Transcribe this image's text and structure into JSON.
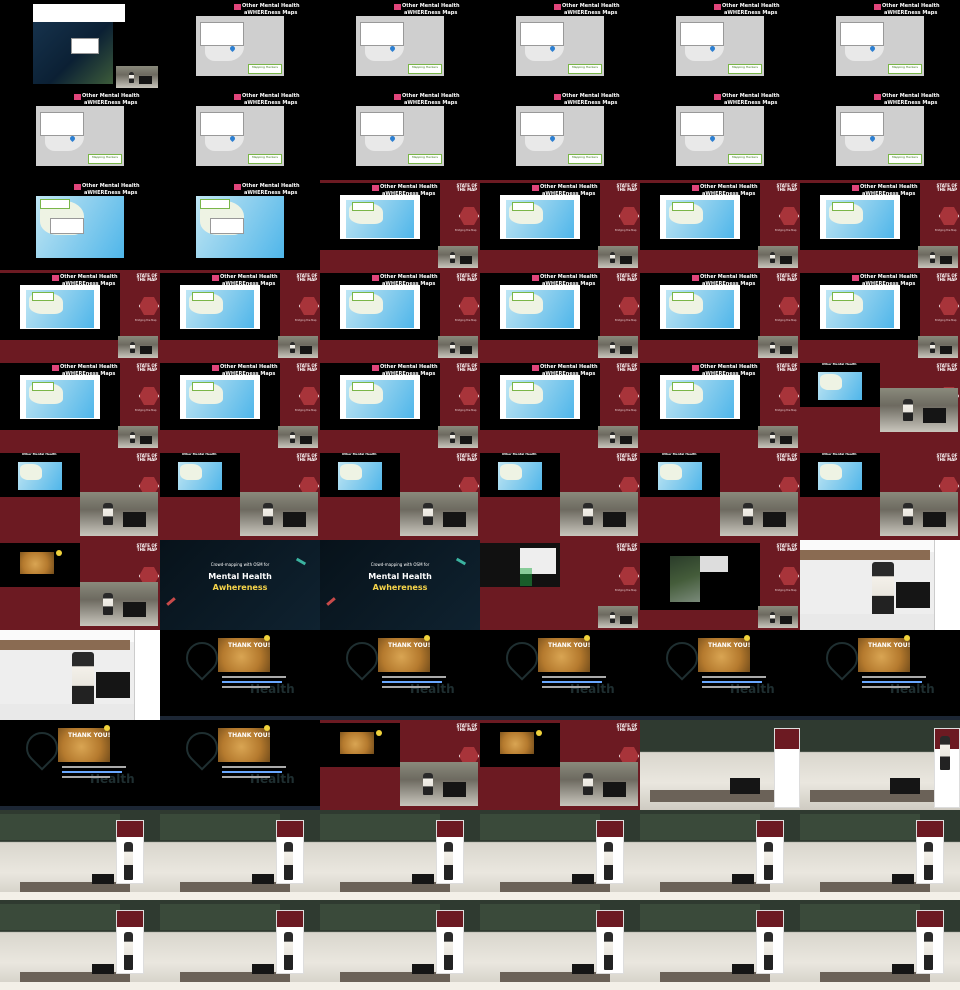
{
  "layout": {
    "columns": 6,
    "rows": 11
  },
  "colors": {
    "maroon": "#6c1a22",
    "black": "#000000",
    "popup_green": "#7ab648",
    "title_pink": "#e0457b"
  },
  "texts": {
    "map_title_line1": "Other Mental Health",
    "map_title_line2": "aWHEREness Maps",
    "map_badge": "Mapping Hackers",
    "sotm_line1": "STATE OF",
    "sotm_line2": "THE MAP",
    "sotm_sub": "Bridging the Map",
    "thank_you": "THANK YOU!",
    "mh_intro": "Crowd-mapping with OSM for",
    "mh_title1": "Mental Health",
    "mh_title2": "Awhereness",
    "mh_health": "Health"
  },
  "frames": [
    "web-map-dark",
    "map-grey",
    "map-grey",
    "map-grey",
    "map-grey",
    "map-grey",
    "map-grey",
    "map-grey",
    "map-grey",
    "map-grey",
    "map-grey",
    "map-grey",
    "map-blue-black",
    "map-blue-black",
    "sotm-map",
    "sotm-map",
    "sotm-map",
    "sotm-map",
    "sotm-map-wide",
    "sotm-map-wide",
    "sotm-map",
    "sotm-map",
    "sotm-map",
    "sotm-map",
    "sotm-map-wide",
    "sotm-map-wide",
    "sotm-map",
    "sotm-map",
    "sotm-map",
    "sotm-speaker-small",
    "sotm-speaker",
    "sotm-speaker",
    "sotm-speaker",
    "sotm-speaker",
    "sotm-speaker",
    "sotm-speaker",
    "sotm-bear",
    "title-slide",
    "title-slide",
    "sotm-osm",
    "sotm-satellite",
    "speaker-close",
    "speaker-close",
    "thankyou",
    "thankyou",
    "thankyou",
    "thankyou",
    "thankyou",
    "thankyou",
    "thankyou",
    "sotm-bear",
    "sotm-bear",
    "hall-wide",
    "hall-speaker",
    "hall",
    "hall",
    "hall",
    "hall",
    "hall",
    "hall",
    "hall",
    "hall",
    "hall",
    "hall",
    "hall",
    "hall"
  ]
}
